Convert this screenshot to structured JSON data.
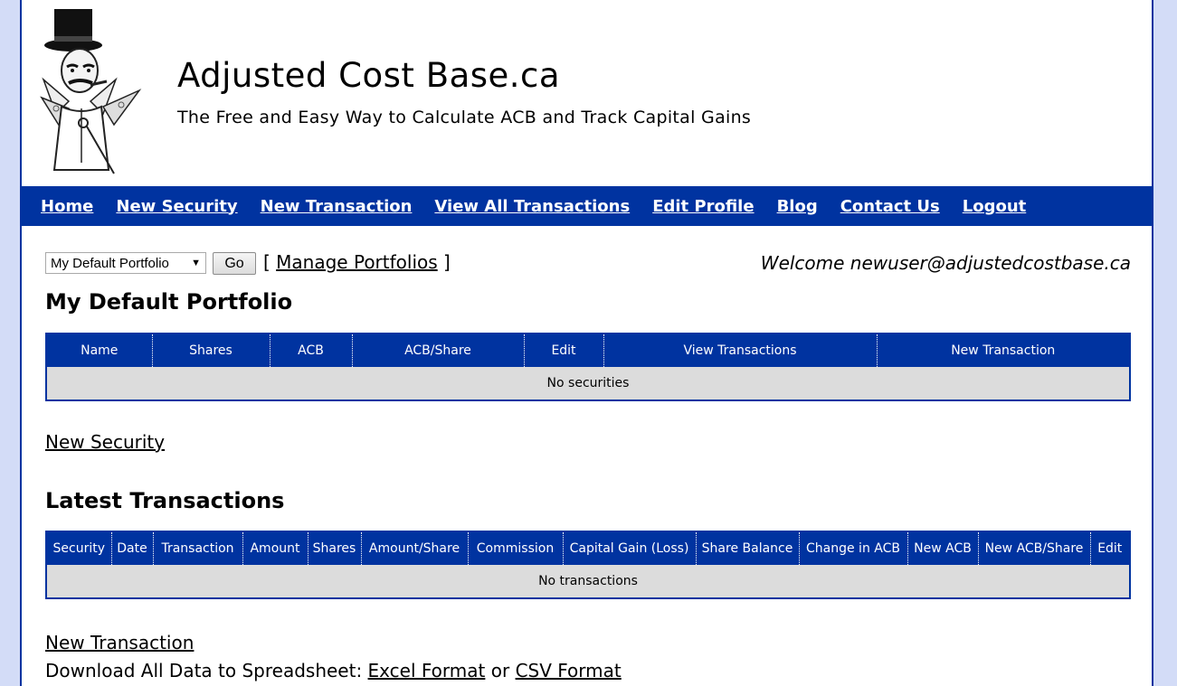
{
  "site": {
    "title": "Adjusted Cost Base.ca",
    "tagline": "The Free and Easy Way to Calculate ACB and Track Capital Gains"
  },
  "nav": [
    "Home",
    "New Security",
    "New Transaction",
    "View All Transactions",
    "Edit Profile",
    "Blog",
    "Contact Us",
    "Logout"
  ],
  "portfolio": {
    "selected": "My Default Portfolio",
    "go_label": "Go",
    "manage_prefix": "[",
    "manage_label": "Manage Portfolios",
    "manage_suffix": "]",
    "welcome": "Welcome newuser@adjustedcostbase.ca",
    "title": "My Default Portfolio"
  },
  "securities_table": {
    "columns": [
      "Name",
      "Shares",
      "ACB",
      "ACB/Share",
      "Edit",
      "View Transactions",
      "New Transaction"
    ],
    "empty_text": "No securities"
  },
  "new_security_link": "New Security",
  "transactions": {
    "title": "Latest Transactions",
    "columns": [
      "Security",
      "Date",
      "Transaction",
      "Amount",
      "Shares",
      "Amount/Share",
      "Commission",
      "Capital Gain (Loss)",
      "Share Balance",
      "Change in ACB",
      "New ACB",
      "New ACB/Share",
      "Edit"
    ],
    "empty_text": "No transactions"
  },
  "footer": {
    "new_transaction_link": "New Transaction",
    "download_prefix": "Download All Data to Spreadsheet:",
    "excel_label": "Excel Format",
    "or_text": "or",
    "csv_label": "CSV Format"
  },
  "colors": {
    "brand": "#0033a0",
    "background": "#d3dcf7",
    "empty_row": "#dcdcdc"
  }
}
